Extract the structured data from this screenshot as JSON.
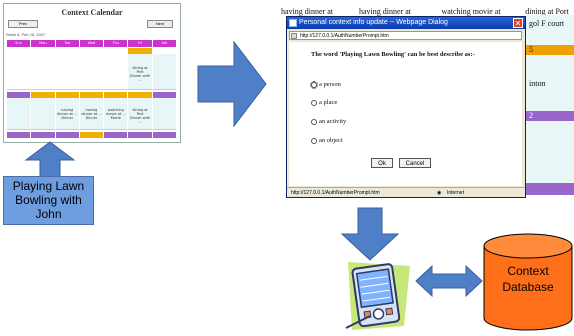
{
  "calendar_thumb": {
    "title": "Context Calendar",
    "prev_label": "Prev",
    "next_label": "Next",
    "subtitle": "Week 8, Feb 18, 2007",
    "days": [
      "Sun",
      "Mon",
      "Tue",
      "Wed",
      "Thu",
      "Fri",
      "Sat"
    ],
    "event_label": "dining at Port",
    "event_sub": "Dinner with ...",
    "mid_events": [
      "having dinner at ...",
      "having dinner at ...",
      "watching movie at ...",
      "dining at Port"
    ],
    "mid_sub": [
      "Dinner",
      "Dinner",
      "Movie",
      "Dinner with ..."
    ]
  },
  "caption": {
    "text": "Playing Lawn Bowling with John"
  },
  "bg_calendar": {
    "col_headers": [
      "having dinner at",
      "having dinner at",
      "watching movie at",
      "dining at Port"
    ],
    "right_snippets": [
      "gol F court",
      "5",
      "inton",
      "2"
    ]
  },
  "dialog": {
    "title": "Personal context info update -- Webpage Dialog",
    "url": "http://127.0.0.1/AuthNumberPrompt.htm",
    "question": "The word 'Playing Lawn Bowling' can be best describe as:-",
    "options": [
      "a person",
      "a place",
      "an activity",
      "an object"
    ],
    "ok_label": "Ok",
    "cancel_label": "Cancel",
    "status_url": "http://127.0.0.1/AuthNumberPrompt.htm",
    "status_zone": "Internet"
  },
  "database": {
    "label": "Context Database"
  },
  "colors": {
    "arrow_blue": "#4f7fc7",
    "db_orange": "#ff6f1a",
    "title_blue": "#0a3cb0",
    "caption_blue": "#6e9ee0"
  },
  "icons": [
    "close-icon",
    "page-icon",
    "globe-icon",
    "pda-icon",
    "database-icon",
    "arrow-right-icon",
    "arrow-down-icon",
    "arrow-up-icon",
    "double-arrow-icon"
  ]
}
